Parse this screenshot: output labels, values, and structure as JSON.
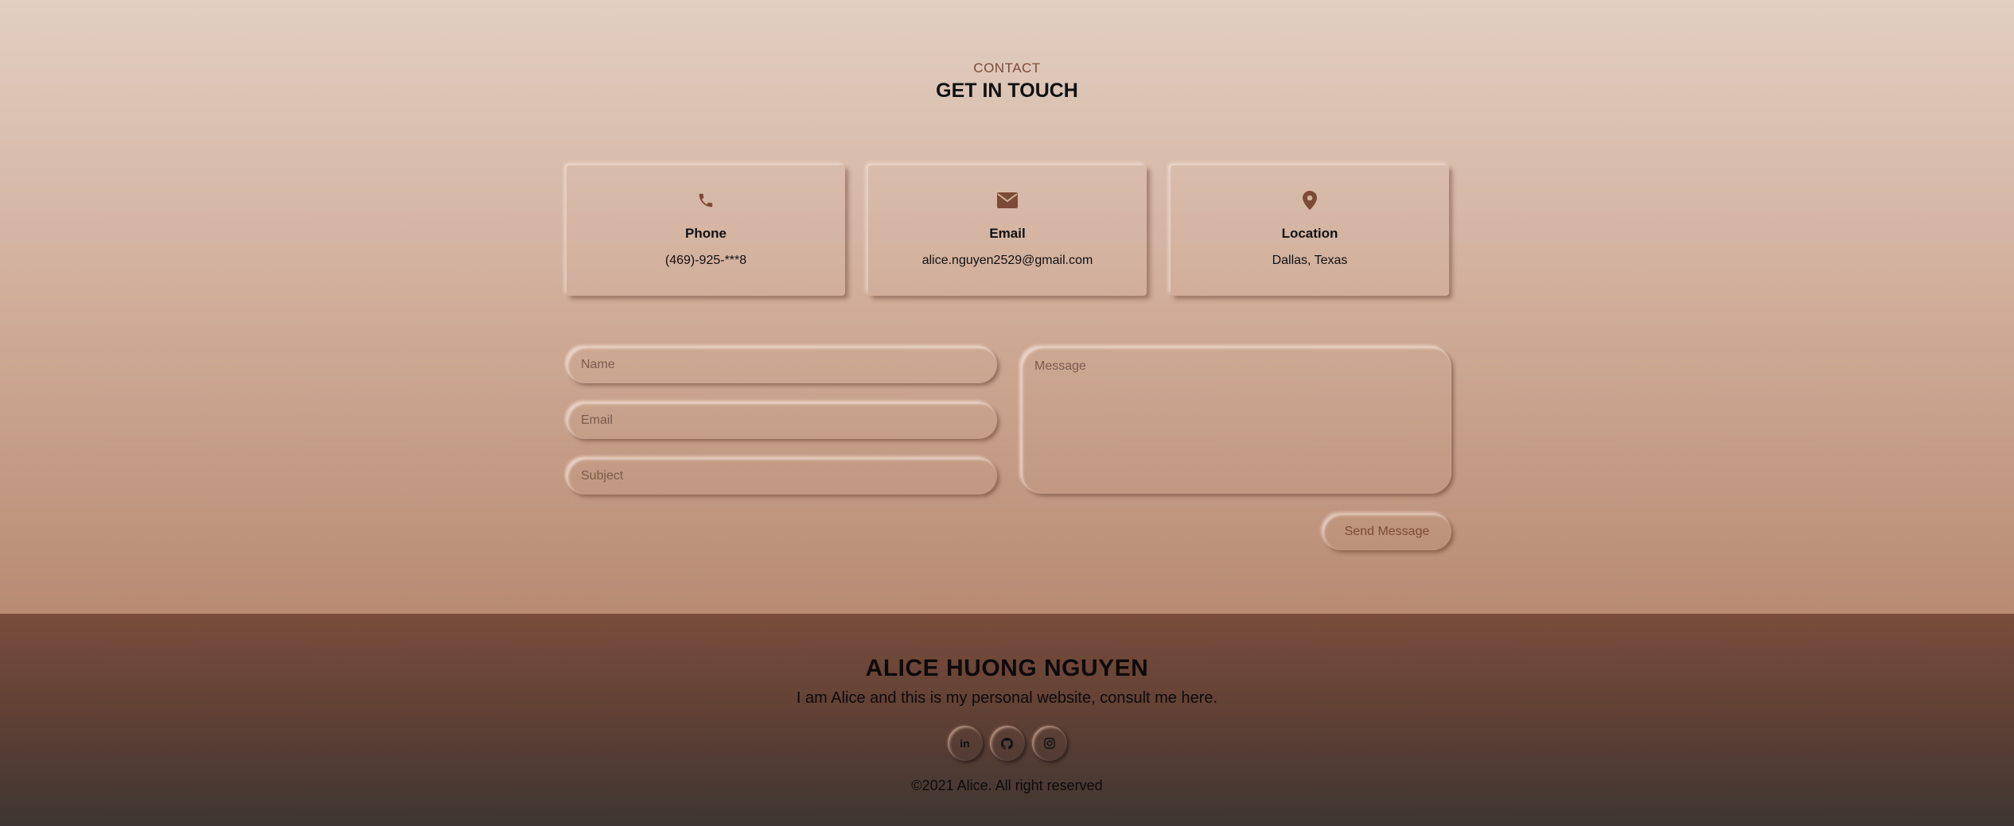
{
  "contact": {
    "kicker": "CONTACT",
    "title": "GET IN TOUCH",
    "cards": [
      {
        "icon": "phone-icon",
        "label": "Phone",
        "value": "(469)-925-***8"
      },
      {
        "icon": "envelope-icon",
        "label": "Email",
        "value": "alice.nguyen2529@gmail.com"
      },
      {
        "icon": "map-pin-icon",
        "label": "Location",
        "value": "Dallas, Texas"
      }
    ]
  },
  "form": {
    "name_placeholder": "Name",
    "email_placeholder": "Email",
    "subject_placeholder": "Subject",
    "message_placeholder": "Message",
    "send_label": "Send Message"
  },
  "footer": {
    "name": "ALICE HUONG NGUYEN",
    "tagline": "I am Alice and this is my personal website, consult me here.",
    "socials": [
      {
        "icon": "linkedin-icon",
        "text": "in"
      },
      {
        "icon": "github-icon",
        "text": ""
      },
      {
        "icon": "instagram-icon",
        "text": ""
      }
    ],
    "copyright": "©2021 Alice. All right reserved"
  },
  "colors": {
    "accent": "#7c4a36",
    "page_top": "#e2cfc2",
    "page_bottom": "#b88b72",
    "footer_top": "#7a4d3c",
    "footer_bottom": "#3e3532"
  }
}
